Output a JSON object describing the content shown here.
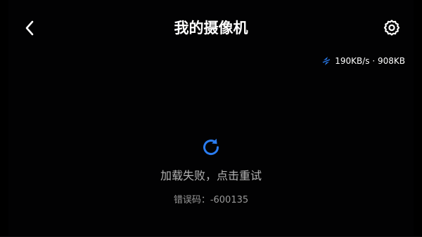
{
  "header": {
    "title": "我的摄像机",
    "back_icon": "chevron-left-icon",
    "settings_icon": "gear-icon"
  },
  "stream": {
    "speed_icon": "transfer-speed-icon",
    "speed_text": "190KB/s · 908KB"
  },
  "status": {
    "retry_icon": "refresh-icon",
    "message": "加载失败，点击重试",
    "error_code": "错误码：-600135"
  },
  "colors": {
    "background": "#000000",
    "accent": "#2a7cf0",
    "text_primary": "#ffffff",
    "text_secondary": "#b3b3b3"
  }
}
